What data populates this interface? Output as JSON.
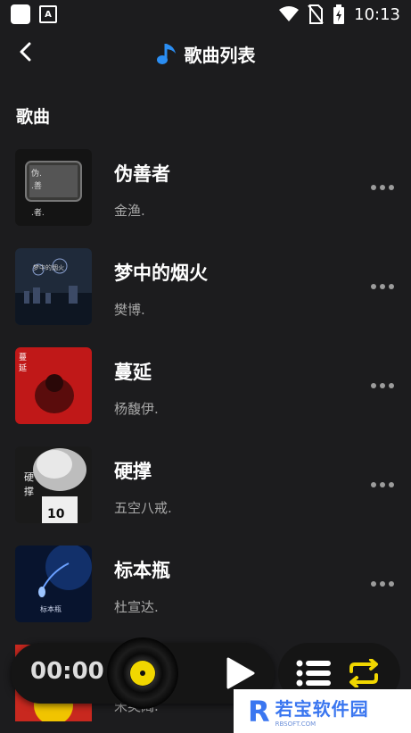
{
  "status_bar": {
    "time": "10:13",
    "icons": [
      "app-square-icon",
      "accessibility-a-icon",
      "wifi-icon",
      "no-sim-icon",
      "battery-icon"
    ]
  },
  "header": {
    "title": "歌曲列表",
    "back_icon": "back-arrow-icon",
    "music_icon": "music-note-icon"
  },
  "section_label": "歌曲",
  "songs": [
    {
      "title": "伪善者",
      "artist": "金渔."
    },
    {
      "title": "梦中的烟火",
      "artist": "樊博."
    },
    {
      "title": "蔓延",
      "artist": "杨馥伊."
    },
    {
      "title": "硬撑",
      "artist": "五空八戒."
    },
    {
      "title": "标本瓶",
      "artist": "杜宣达."
    }
  ],
  "partial_song": {
    "artist": "宋英阔."
  },
  "player": {
    "time": "00:00",
    "accent": "#f1d700"
  },
  "watermark": {
    "letter": "R",
    "text": "若宝软件园",
    "sub": "RBSOFT.COM"
  }
}
